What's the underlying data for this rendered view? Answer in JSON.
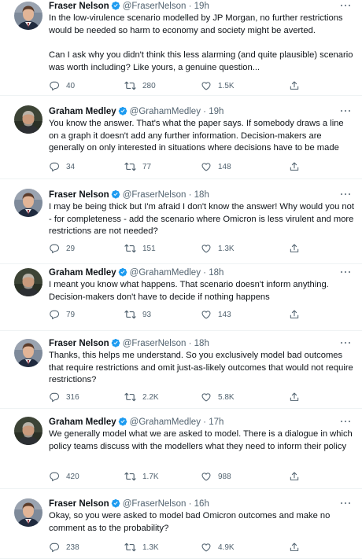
{
  "tweets": [
    {
      "name": "Fraser Nelson",
      "handle": "@FraserNelson",
      "dot": "·",
      "time": "19h",
      "text": "In the low-virulence scenario modelled by JP Morgan, no further restrictions would be needed so harm to economy and society might be averted.\n\nCan I ask why you didn't think this less alarming (and quite plausible) scenario was worth including? Like yours, a genuine question...",
      "replies": "40",
      "retweets": "280",
      "likes": "1.5K",
      "avatar": "fraser"
    },
    {
      "name": "Graham Medley",
      "handle": "@GrahamMedley",
      "dot": "·",
      "time": "19h",
      "text": "You know the answer. That's what the paper says. If somebody draws a line on a graph it doesn't add any further information. Decision-makers are generally on only interested in situations where decisions have to be made",
      "replies": "34",
      "retweets": "77",
      "likes": "148",
      "avatar": "graham"
    },
    {
      "name": "Fraser Nelson",
      "handle": "@FraserNelson",
      "dot": "·",
      "time": "18h",
      "text": "I may be being thick but I'm afraid I don't know the answer! Why would you not - for completeness - add the scenario where Omicron is less virulent and more restrictions are not needed?",
      "replies": "29",
      "retweets": "151",
      "likes": "1.3K",
      "avatar": "fraser"
    },
    {
      "name": "Graham Medley",
      "handle": "@GrahamMedley",
      "dot": "·",
      "time": "18h",
      "text": "I meant you know what happens. That scenario doesn't inform anything. Decision-makers don't have to decide if nothing happens",
      "replies": "79",
      "retweets": "93",
      "likes": "143",
      "avatar": "graham"
    },
    {
      "name": "Fraser Nelson",
      "handle": "@FraserNelson",
      "dot": "·",
      "time": "18h",
      "text": "Thanks, this helps me understand. So you exclusively model bad outcomes that require restrictions and omit just-as-likely outcomes that would not require restrictions?",
      "replies": "316",
      "retweets": "2.2K",
      "likes": "5.8K",
      "avatar": "fraser"
    },
    {
      "name": "Graham Medley",
      "handle": "@GrahamMedley",
      "dot": "·",
      "time": "17h",
      "text": "We generally model what we are asked to model. There is a dialogue in which policy teams discuss with the modellers what they need to inform their policy",
      "replies": "420",
      "retweets": "1.7K",
      "likes": "988",
      "avatar": "graham"
    },
    {
      "name": "Fraser Nelson",
      "handle": "@FraserNelson",
      "dot": "·",
      "time": "16h",
      "text": "Okay, so you were asked to model bad Omicron outcomes and make no comment as to the probability?",
      "replies": "238",
      "retweets": "1.3K",
      "likes": "4.9K",
      "avatar": "fraser"
    }
  ],
  "colors": {
    "text": "#0f1419",
    "secondary": "#536471",
    "verified": "#1d9bf0",
    "divider": "#eff3f4"
  },
  "icons": [
    "reply-icon",
    "retweet-icon",
    "like-icon",
    "share-icon",
    "verified-badge-icon",
    "more-icon"
  ]
}
